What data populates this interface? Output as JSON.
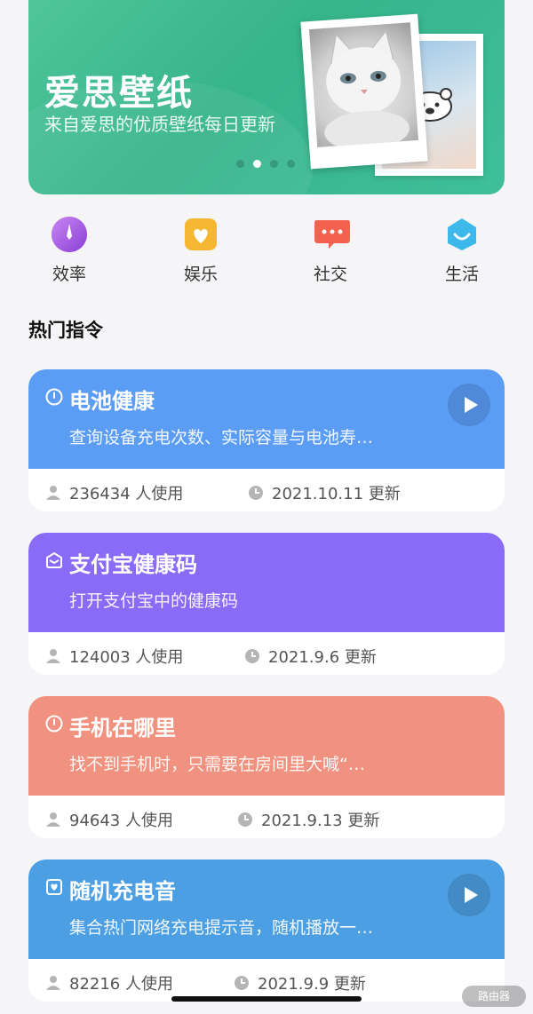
{
  "banner": {
    "title": "爱思壁纸",
    "subtitle": "来自爱思的优质壁纸每日更新",
    "slides": 4,
    "active_slide": 2
  },
  "categories": [
    {
      "label": "效率",
      "icon": "compass-icon",
      "color": "#a45be0"
    },
    {
      "label": "娱乐",
      "icon": "heart-icon",
      "color": "#f5b731"
    },
    {
      "label": "社交",
      "icon": "chat-bubble-icon",
      "color": "#f4614f"
    },
    {
      "label": "生活",
      "icon": "smile-hexagon-icon",
      "color": "#3cb8ea"
    }
  ],
  "section_title": "热门指令",
  "commands": [
    {
      "title": "电池健康",
      "desc": "查询设备充电次数、实际容量与电池寿…",
      "users": "236434 人使用",
      "updated": "2021.10.11 更新",
      "color": "#5b9df5",
      "icon": "clock-icon",
      "has_play": true
    },
    {
      "title": "支付宝健康码",
      "desc": "打开支付宝中的健康码",
      "users": "124003 人使用",
      "updated": "2021.9.6 更新",
      "color": "#8a6bf7",
      "icon": "box-open-icon",
      "has_play": false
    },
    {
      "title": "手机在哪里",
      "desc": "找不到手机时，只需要在房间里大喊“…",
      "users": "94643 人使用",
      "updated": "2021.9.13 更新",
      "color": "#f0927f",
      "icon": "clock-icon",
      "has_play": false
    },
    {
      "title": "随机充电音",
      "desc": "集合热门网络充电提示音，随机播放一…",
      "users": "82216 人使用",
      "updated": "2021.9.9 更新",
      "color": "#4d9fe3",
      "icon": "heart-square-icon",
      "has_play": true
    }
  ],
  "watermark": "路由器"
}
